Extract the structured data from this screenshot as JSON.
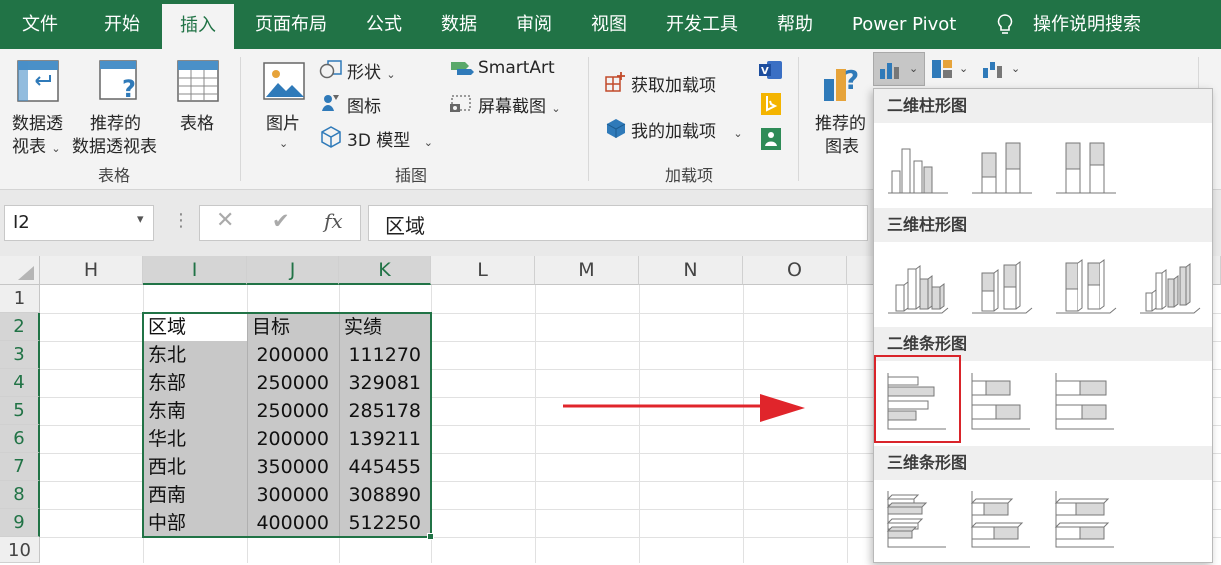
{
  "tabs": [
    "文件",
    "开始",
    "插入",
    "页面布局",
    "公式",
    "数据",
    "审阅",
    "视图",
    "开发工具",
    "帮助",
    "Power Pivot",
    "操作说明搜索"
  ],
  "active_tab": "插入",
  "ribbon": {
    "pivot_line1": "数据透",
    "pivot_line2": "视表",
    "recommended_pivot_line1": "推荐的",
    "recommended_pivot_line2": "数据透视表",
    "table": "表格",
    "group_table": "表格",
    "picture": "图片",
    "shapes": "形状",
    "icons": "图标",
    "model3d": "3D 模型",
    "smartart": "SmartArt",
    "screenshot": "屏幕截图",
    "group_illustrations": "插图",
    "get_addins": "获取加载项",
    "my_addins": "我的加载项",
    "group_addins": "加载项",
    "recommended_charts_line1": "推荐的",
    "recommended_charts_line2": "图表"
  },
  "formula_bar": {
    "name_box": "I2",
    "value": "区域"
  },
  "columns": [
    "H",
    "I",
    "J",
    "K",
    "L",
    "M",
    "N",
    "O"
  ],
  "rows": [
    "1",
    "2",
    "3",
    "4",
    "5",
    "6",
    "7",
    "8",
    "9",
    "10"
  ],
  "table": {
    "headers": [
      "区域",
      "目标",
      "实绩"
    ],
    "rows": [
      [
        "东北",
        "200000",
        "111270"
      ],
      [
        "东部",
        "250000",
        "329081"
      ],
      [
        "东南",
        "250000",
        "285178"
      ],
      [
        "华北",
        "200000",
        "139211"
      ],
      [
        "西北",
        "350000",
        "445455"
      ],
      [
        "西南",
        "300000",
        "308890"
      ],
      [
        "中部",
        "400000",
        "512250"
      ]
    ]
  },
  "dropdown": {
    "sections": [
      "二维柱形图",
      "三维柱形图",
      "二维条形图",
      "三维条形图"
    ]
  },
  "colors": {
    "excel_green": "#217346",
    "arrow_red": "#e0252b",
    "highlight_red": "#d9242a",
    "selection_gray": "#c8c8c8"
  }
}
